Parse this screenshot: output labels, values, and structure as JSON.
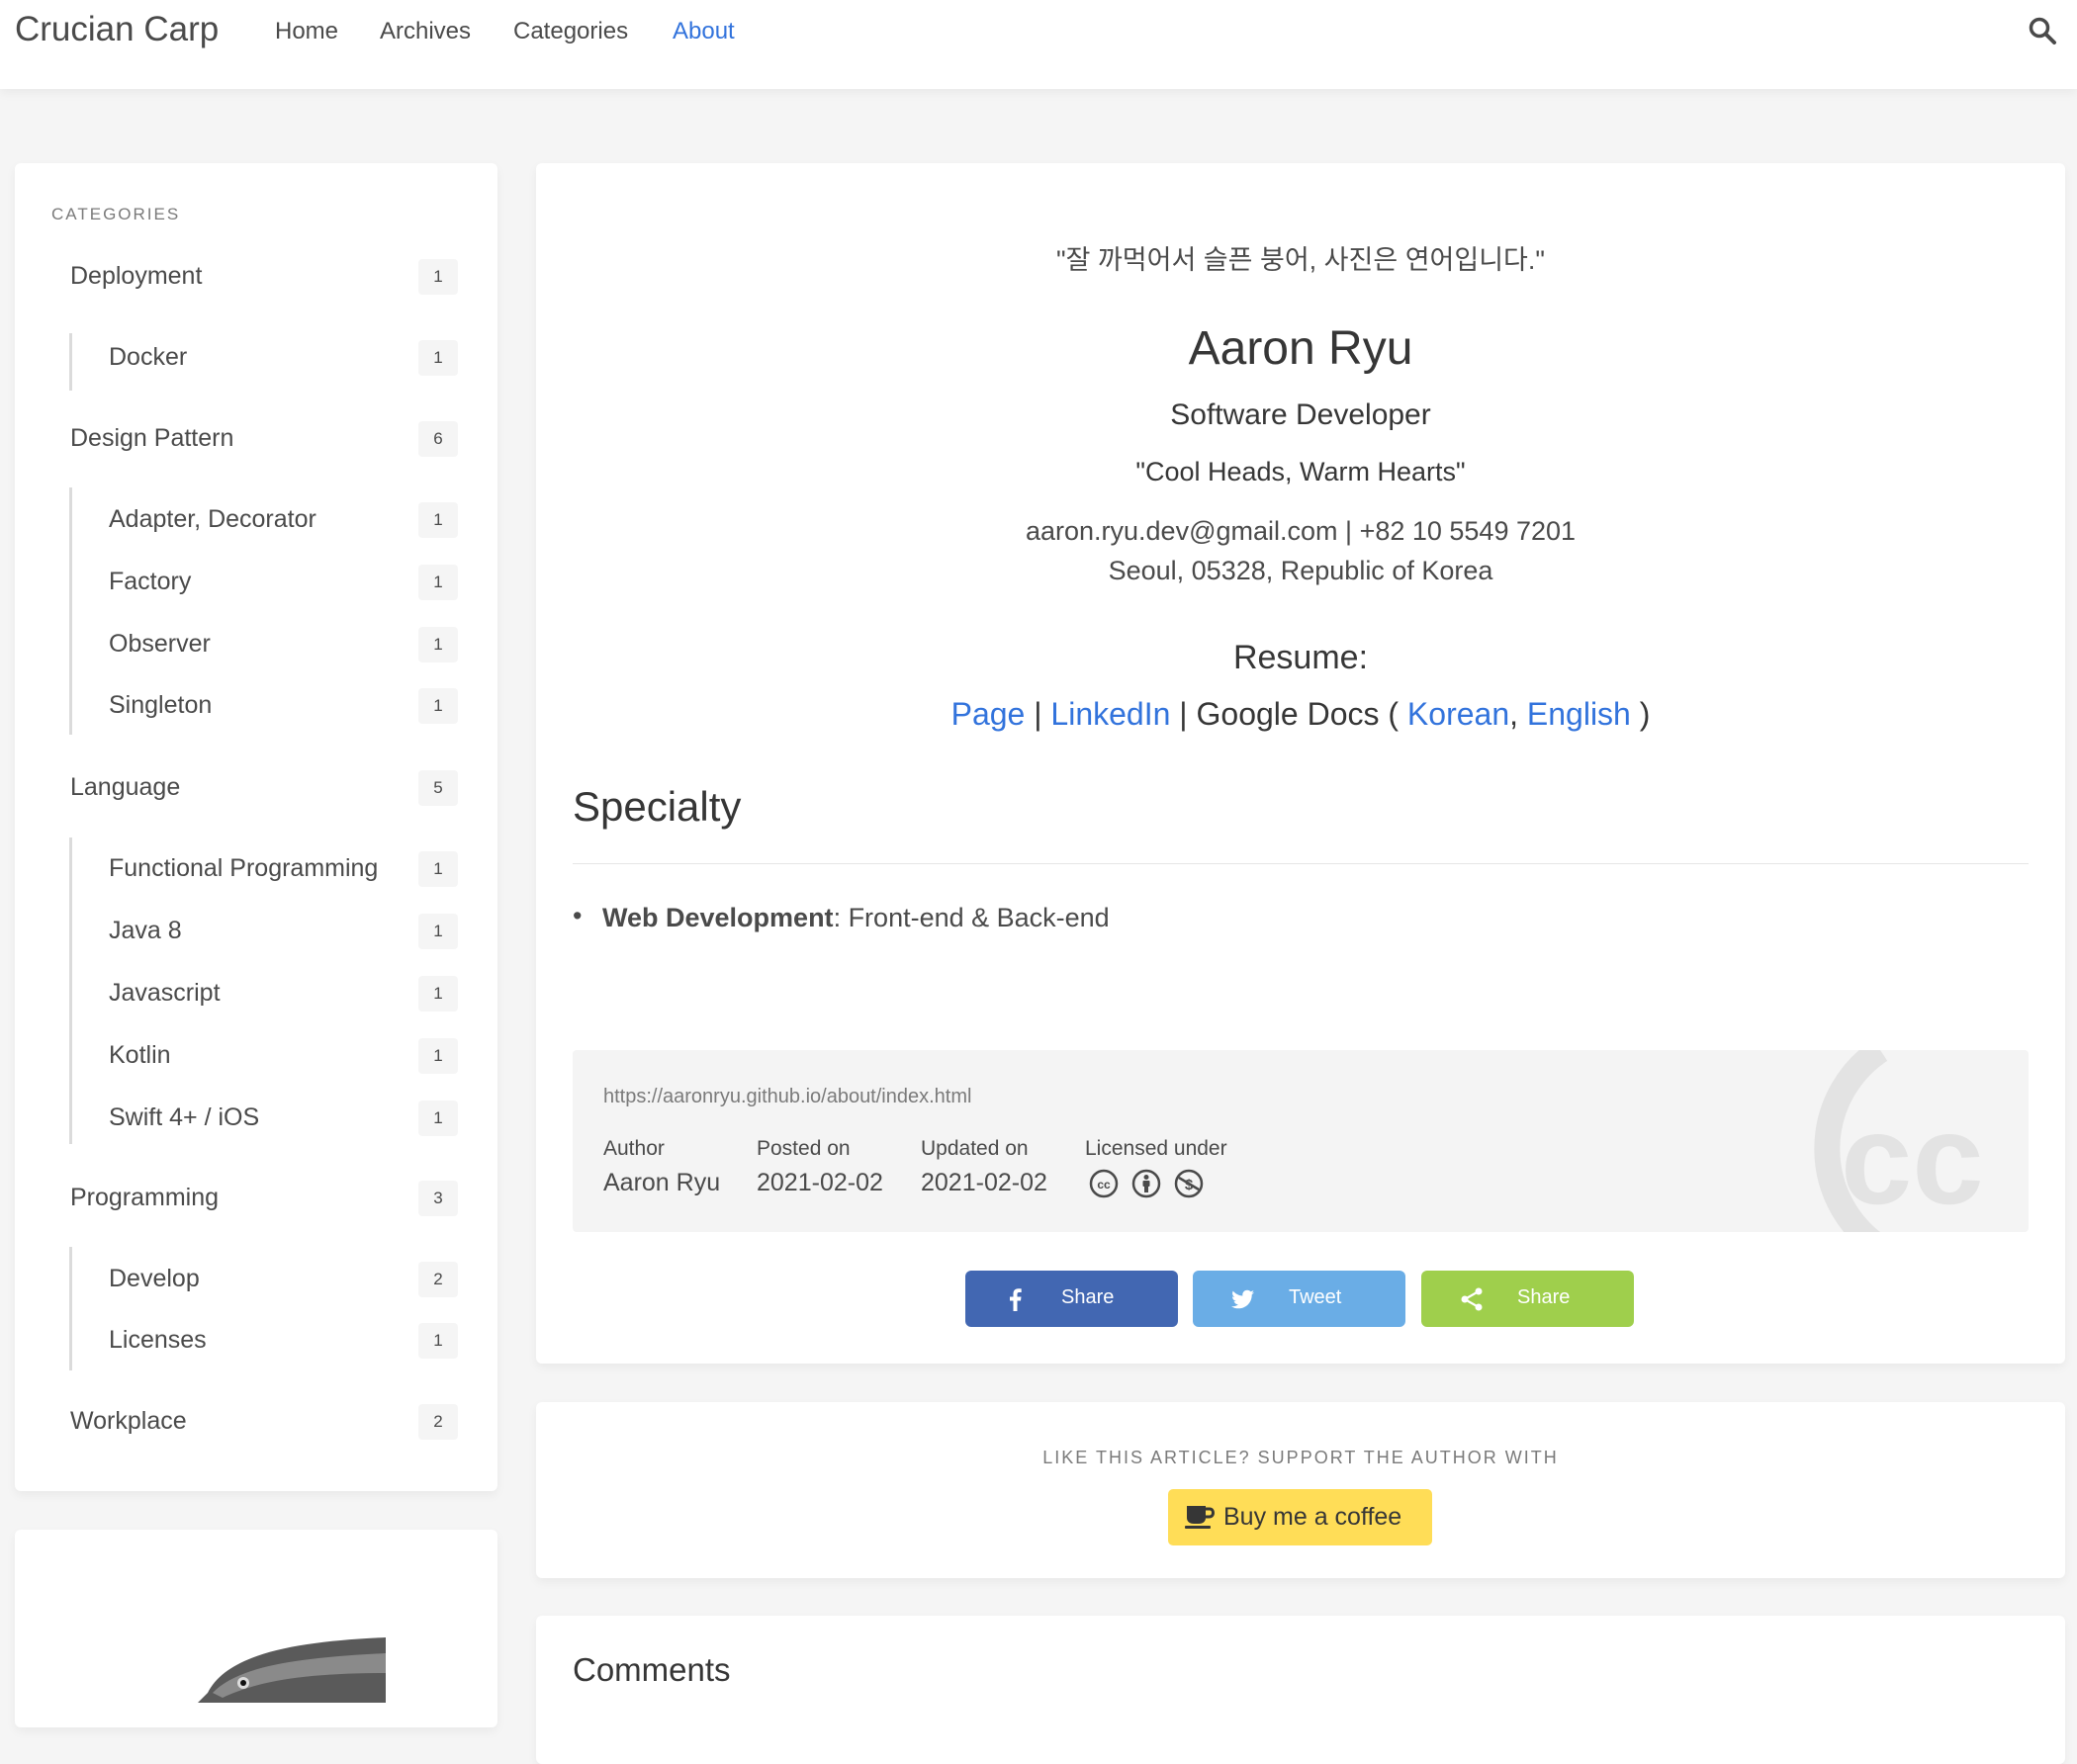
{
  "navbar": {
    "brand": "Crucian Carp",
    "items": [
      "Home",
      "Archives",
      "Categories",
      "About"
    ],
    "active": "About"
  },
  "sidebar": {
    "heading": "CATEGORIES",
    "categories": [
      {
        "label": "Deployment",
        "count": "1",
        "children": [
          {
            "label": "Docker",
            "count": "1"
          }
        ]
      },
      {
        "label": "Design Pattern",
        "count": "6",
        "children": [
          {
            "label": "Adapter, Decorator",
            "count": "1"
          },
          {
            "label": "Factory",
            "count": "1"
          },
          {
            "label": "Observer",
            "count": "1"
          },
          {
            "label": "Singleton",
            "count": "1"
          }
        ]
      },
      {
        "label": "Language",
        "count": "5",
        "children": [
          {
            "label": "Functional Programming",
            "count": "1"
          },
          {
            "label": "Java 8",
            "count": "1"
          },
          {
            "label": "Javascript",
            "count": "1"
          },
          {
            "label": "Kotlin",
            "count": "1"
          },
          {
            "label": "Swift 4+ / iOS",
            "count": "1"
          }
        ]
      },
      {
        "label": "Programming",
        "count": "3",
        "children": [
          {
            "label": "Develop",
            "count": "2"
          },
          {
            "label": "Licenses",
            "count": "1"
          }
        ]
      },
      {
        "label": "Workplace",
        "count": "2",
        "children": []
      }
    ]
  },
  "profile": {
    "quote_kr": "\"잘 까먹어서 슬픈 붕어, 사진은 연어입니다.\"",
    "name": "Aaron Ryu",
    "role": "Software Developer",
    "motto": "\"Cool Heads, Warm Hearts\"",
    "email": "aaron.ryu.dev@gmail.com",
    "sep": "|",
    "phone": "+82 10 5549 7201",
    "address": "Seoul, 05328, Republic of Korea",
    "resume_heading": "Resume:",
    "resume_links": {
      "page": "Page",
      "linkedin": "LinkedIn",
      "google_docs": "Google Docs",
      "korean": "Korean",
      "english": "English"
    }
  },
  "specialty": {
    "title": "Specialty",
    "items": [
      {
        "bold": "Web Development",
        "rest": ": Front-end & Back-end"
      }
    ]
  },
  "license": {
    "url": "https://aaronryu.github.io/about/index.html",
    "author_label": "Author",
    "author": "Aaron Ryu",
    "posted_label": "Posted on",
    "posted": "2021-02-02",
    "updated_label": "Updated on",
    "updated": "2021-02-02",
    "licensed_label": "Licensed under",
    "icons": [
      "cc-icon",
      "by-icon",
      "nc-icon"
    ]
  },
  "share": {
    "facebook": "Share",
    "twitter": "Tweet",
    "sharethis": "Share",
    "colors": {
      "facebook": "#4267b2",
      "twitter": "#6aade6",
      "sharethis": "#9fcf4c"
    }
  },
  "support": {
    "label": "LIKE THIS ARTICLE? SUPPORT THE AUTHOR WITH",
    "button": "Buy me a coffee"
  },
  "comments": {
    "title": "Comments"
  }
}
